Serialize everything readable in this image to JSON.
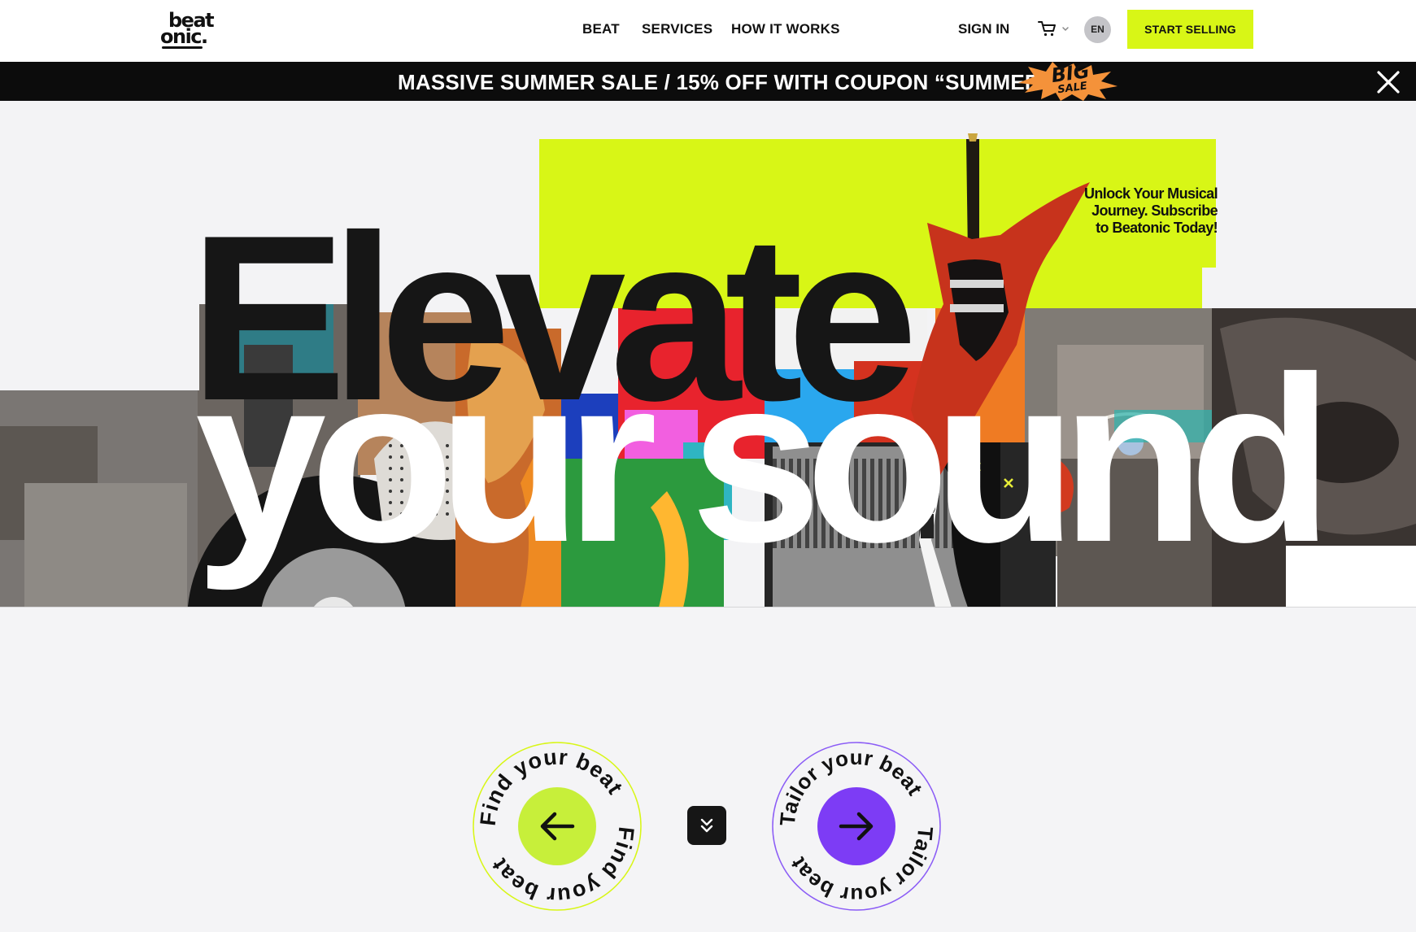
{
  "header": {
    "logo": {
      "line1": "beat",
      "line2": "onic."
    },
    "nav": [
      "BEAT",
      "SERVICES",
      "HOW IT WORKS"
    ],
    "sign_in": "SIGN IN",
    "language": "EN",
    "cta": "START SELLING"
  },
  "banner": {
    "text": "MASSIVE SUMMER SALE / 15% OFF WITH COUPON “SUMMER23”",
    "badge_line1": "BIG",
    "badge_line2": "SALE"
  },
  "hero": {
    "title_line1": "Elevate",
    "title_line2": "your sound",
    "tagline": "Unlock Your Musical Journey. Subscribe to Beatonic Today!"
  },
  "actions": {
    "find": "Find your beat",
    "tailor": "Tailor your beat"
  },
  "colors": {
    "accent_lime": "#d8f616",
    "accent_purple": "#7d3cf5",
    "dark": "#161616"
  },
  "icons": [
    "cart-icon",
    "chevron-down-icon",
    "close-icon",
    "arrow-left-icon",
    "arrow-right-icon",
    "double-chevron-down-icon"
  ]
}
